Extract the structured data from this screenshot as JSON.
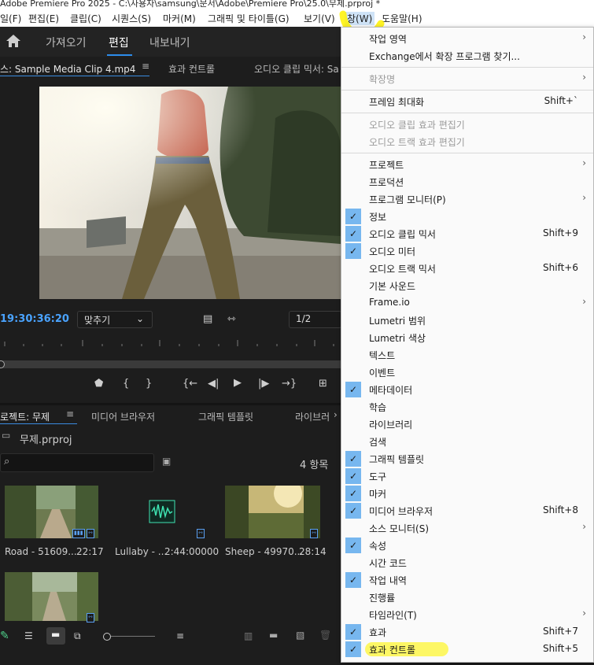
{
  "title_bar": {
    "text": "Adobe Premiere Pro 2025 - C:\\사용자\\samsung\\문서\\Adobe\\Premiere Pro\\25.0\\무제.prproj *"
  },
  "menubar": {
    "items": [
      "일(F)",
      "편집(E)",
      "클립(C)",
      "시퀀스(S)",
      "마커(M)",
      "그래픽 및 타이틀(G)",
      "보기(V)",
      "창(W)",
      "도움말(H)"
    ]
  },
  "workspace": {
    "tabs": [
      "가져오기",
      "편집",
      "내보내기"
    ],
    "active": "편집"
  },
  "source_panel": {
    "tabs": [
      "스: Sample Media Clip 4.mp4",
      "효과 컨트롤",
      "오디오 클립 믹서: Sa"
    ],
    "timecode": "19:30:36:20",
    "fit_label": "맞추기",
    "resolution": "1/2"
  },
  "project_panel": {
    "tabs": [
      "로젝트: 무제",
      "미디어 브라우저",
      "그래픽 템플릿",
      "라이브러"
    ],
    "project_file": "무제.prproj",
    "item_count": "4 항목",
    "items": [
      {
        "name": "Road - 51609...",
        "duration": "22:17"
      },
      {
        "name": "Lullaby - ...",
        "duration": "2:44:00000"
      },
      {
        "name": "Sheep - 49970...",
        "duration": "28:14"
      },
      {
        "name": "",
        "duration": ""
      }
    ]
  },
  "window_menu": {
    "items": [
      {
        "label": "작업 영역",
        "submenu": true
      },
      {
        "label": "Exchange에서 확장 프로그램 찾기..."
      },
      {
        "separator": true
      },
      {
        "label": "확장명",
        "submenu": true,
        "disabled": true
      },
      {
        "separator": true
      },
      {
        "label": "프레임 최대화",
        "shortcut": "Shift+`"
      },
      {
        "separator": true
      },
      {
        "label": "오디오 클립 효과 편집기",
        "disabled": true
      },
      {
        "label": "오디오 트랙 효과 편집기",
        "disabled": true
      },
      {
        "separator": true
      },
      {
        "label": "프로젝트",
        "submenu": true
      },
      {
        "label": "프로덕션"
      },
      {
        "label": "프로그램 모니터(P)",
        "submenu": true
      },
      {
        "label": "정보",
        "checked": true
      },
      {
        "label": "오디오 클립 믹서",
        "shortcut": "Shift+9",
        "checked": true
      },
      {
        "label": "오디오 미터",
        "checked": true
      },
      {
        "label": "오디오 트랙 믹서",
        "shortcut": "Shift+6"
      },
      {
        "label": "기본 사운드"
      },
      {
        "label": "Frame.io",
        "submenu": true
      },
      {
        "label": "Lumetri 범위"
      },
      {
        "label": "Lumetri 색상"
      },
      {
        "label": "텍스트"
      },
      {
        "label": "이벤트"
      },
      {
        "label": "메타데이터",
        "checked": true
      },
      {
        "label": "학습"
      },
      {
        "label": "라이브러리"
      },
      {
        "label": "검색"
      },
      {
        "label": "그래픽 템플릿",
        "checked": true
      },
      {
        "label": "도구",
        "checked": true
      },
      {
        "label": "마커",
        "checked": true
      },
      {
        "label": "미디어 브라우저",
        "shortcut": "Shift+8",
        "checked": true
      },
      {
        "label": "소스 모니터(S)",
        "submenu": true
      },
      {
        "label": "속성",
        "checked": true
      },
      {
        "label": "시간 코드"
      },
      {
        "label": "작업 내역",
        "checked": true
      },
      {
        "label": "진행률"
      },
      {
        "label": "타임라인(T)",
        "submenu": true
      },
      {
        "label": "효과",
        "shortcut": "Shift+7",
        "checked": true
      },
      {
        "label": "효과 컨트롤",
        "shortcut": "Shift+5",
        "checked": true
      }
    ]
  },
  "colors": {
    "accent": "#2d8ceb",
    "timecode": "#4aa3ff",
    "check_bg": "#77b7ef",
    "highlight": "#fff500"
  },
  "icons": [
    "home-icon",
    "hamburger-icon",
    "marker-icon",
    "in-point-icon",
    "out-point-icon",
    "go-to-in-icon",
    "step-back-icon",
    "play-icon",
    "step-forward-icon",
    "go-to-out-icon",
    "export-frame-icon",
    "search-icon",
    "new-bin-icon",
    "pencil-icon",
    "list-view-icon",
    "icon-view-icon",
    "freeform-view-icon",
    "sort-icon",
    "automate-icon",
    "folder-icon",
    "new-item-icon",
    "trash-icon",
    "chevron-right-icon",
    "check-icon"
  ]
}
